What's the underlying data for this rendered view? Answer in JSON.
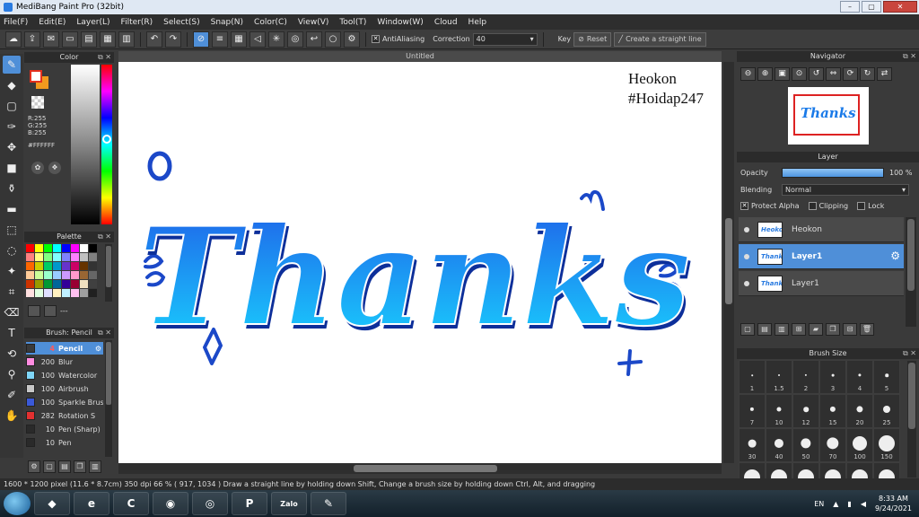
{
  "title": {
    "text": "MediBang Paint Pro (32bit)",
    "min": "–",
    "max": "▢",
    "close": "✕"
  },
  "menu": [
    "File(F)",
    "Edit(E)",
    "Layer(L)",
    "Filter(R)",
    "Select(S)",
    "Snap(N)",
    "Color(C)",
    "View(V)",
    "Tool(T)",
    "Window(W)",
    "Cloud",
    "Help"
  ],
  "toolbar": {
    "antialiasing": "AntiAliasing",
    "correction_label": "Correction",
    "correction_value": "40",
    "key_label": "Key",
    "reset": "Reset",
    "straight": "Create a straight line"
  },
  "color_panel": {
    "title": "Color",
    "r": "R:255",
    "g": "G:255",
    "b": "B:255",
    "hex": "#FFFFFF",
    "fore_color": "#ffffff",
    "back_color": "#f29a1e"
  },
  "palette": {
    "title": "Palette",
    "footer": "---",
    "colors": [
      "#ff0000",
      "#ffff00",
      "#00ff00",
      "#00ffff",
      "#0000ff",
      "#ff00ff",
      "#ffffff",
      "#000000",
      "#ff8080",
      "#ffff80",
      "#80ff80",
      "#80ffff",
      "#8080ff",
      "#ff80ff",
      "#c0c0c0",
      "#808080",
      "#ff6600",
      "#cccc00",
      "#00cc66",
      "#0099cc",
      "#6633cc",
      "#cc0066",
      "#663300",
      "#333333",
      "#ffcc99",
      "#ccff99",
      "#99ffcc",
      "#99ccff",
      "#cc99ff",
      "#ff99cc",
      "#996633",
      "#666666",
      "#cc3300",
      "#999900",
      "#009933",
      "#006699",
      "#330099",
      "#990033",
      "#f0e0c0",
      "#404040",
      "#ffe0e0",
      "#e0ffe0",
      "#e0e0ff",
      "#fff0c0",
      "#c0f0ff",
      "#ffc0f0",
      "#a0a0a0",
      "#202020"
    ]
  },
  "brush_panel": {
    "title": "Brush: Pencil",
    "items": [
      {
        "size": "4",
        "name": "Pencil",
        "color": "#3a3a3a",
        "active": true
      },
      {
        "size": "200",
        "name": "Blur",
        "color": "#ff8ce0"
      },
      {
        "size": "100",
        "name": "Watercolor",
        "color": "#7fd6f8"
      },
      {
        "size": "100",
        "name": "Airbrush",
        "color": "#c8c8c8"
      },
      {
        "size": "100",
        "name": "Sparkle Brush",
        "color": "#3a59d8"
      },
      {
        "size": "282",
        "name": "Rotation S",
        "color": "#e23030"
      },
      {
        "size": "10",
        "name": "Pen (Sharp)",
        "color": "#2a2a2a"
      },
      {
        "size": "10",
        "name": "Pen",
        "color": "#2a2a2a"
      }
    ]
  },
  "document": {
    "tab": "Untitled",
    "signature_line1": "Heokon",
    "signature_line2": "#Hoidap247"
  },
  "navigator": {
    "title": "Navigator",
    "thumb_text": "Thanks"
  },
  "layer_panel": {
    "title": "Layer",
    "opacity_label": "Opacity",
    "opacity_value": "100 %",
    "blending_label": "Blending",
    "blending_value": "Normal",
    "protect_alpha": "Protect Alpha",
    "clipping": "Clipping",
    "lock": "Lock",
    "layers": [
      {
        "name": "Heokon",
        "thumb": "Heokon",
        "active": false
      },
      {
        "name": "Layer1",
        "thumb": "Thanks",
        "active": true
      },
      {
        "name": "Layer1",
        "thumb": "Thanks",
        "active": false
      }
    ]
  },
  "brush_size": {
    "title": "Brush Size",
    "sizes": [
      "1",
      "1.5",
      "2",
      "3",
      "4",
      "5",
      "7",
      "10",
      "12",
      "15",
      "20",
      "25",
      "30",
      "40",
      "50",
      "70",
      "100",
      "150"
    ]
  },
  "status": {
    "text": "1600 * 1200 pixel  (11.6 * 8.7cm)  350 dpi  66 %  ( 917, 1034 )  Draw a straight line by holding down Shift, Change a brush size by holding down Ctrl, Alt, and dragging"
  },
  "taskbar": {
    "lang": "EN",
    "time": "8:33 AM",
    "date": "9/24/2021",
    "zalo": "Zalo"
  },
  "canvas": {
    "text": "Thanks",
    "gradient_top": "#1f5fe8",
    "gradient_bottom": "#19d6ff"
  }
}
